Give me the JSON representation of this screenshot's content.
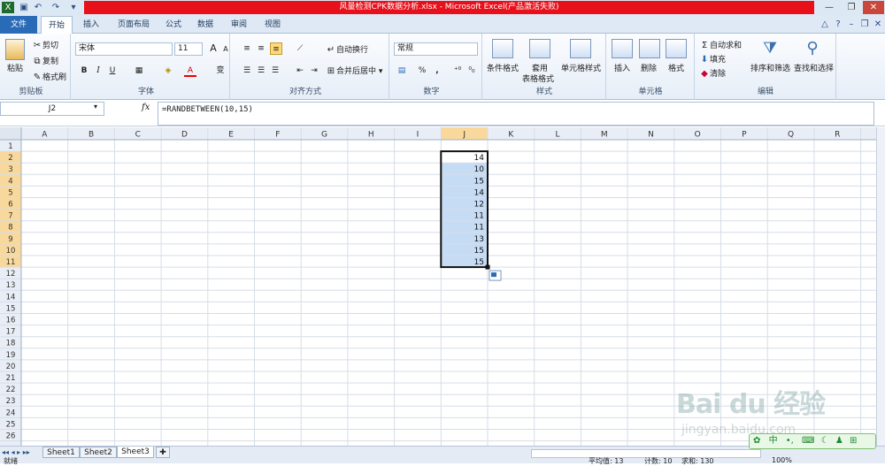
{
  "window": {
    "title": "风量检测CPK数据分析.xlsx  -  Microsoft Excel(产品激活失败)"
  },
  "ribbon_tabs": [
    "文件",
    "开始",
    "插入",
    "页面布局",
    "公式",
    "数据",
    "审阅",
    "视图"
  ],
  "clipboard": {
    "paste": "粘贴",
    "cut": "剪切",
    "copy": "复制",
    "format_painter": "格式刷",
    "group": "剪贴板"
  },
  "font": {
    "name": "宋体",
    "size": "11",
    "group": "字体",
    "bold": "B",
    "italic": "I",
    "underline": "U",
    "increase": "A",
    "decrease": "A",
    "font_color": "A",
    "wen": "变"
  },
  "align": {
    "wrap": "自动换行",
    "merge": "合并后居中",
    "group": "对齐方式"
  },
  "number": {
    "format": "常规",
    "percent": "%",
    "comma": ",",
    "group": "数字"
  },
  "styles": {
    "cond": "条件格式",
    "table1": "套用",
    "table2": "表格格式",
    "cell_style": "单元格样式",
    "group": "样式"
  },
  "cells": {
    "insert": "插入",
    "delete": "删除",
    "format": "格式",
    "group": "单元格"
  },
  "editing": {
    "autosum": "自动求和",
    "fill": "填充",
    "clear": "清除",
    "sort": "排序和筛选",
    "find": "查找和选择",
    "group": "编辑",
    "sigma": "Σ"
  },
  "formula_bar": {
    "name_box": "J2",
    "fx": "fx",
    "formula": "=RANDBETWEEN(10,15)"
  },
  "columns": [
    "A",
    "B",
    "C",
    "D",
    "E",
    "F",
    "G",
    "H",
    "I",
    "J",
    "K",
    "L",
    "M",
    "N",
    "O",
    "P",
    "Q",
    "R"
  ],
  "rows": [
    "1",
    "2",
    "3",
    "4",
    "5",
    "6",
    "7",
    "8",
    "9",
    "10",
    "11",
    "12",
    "13",
    "14",
    "15",
    "16",
    "17",
    "18",
    "19",
    "20",
    "21",
    "22",
    "23",
    "24",
    "25",
    "26"
  ],
  "j_values": [
    "14",
    "10",
    "15",
    "14",
    "12",
    "11",
    "11",
    "13",
    "15",
    "15"
  ],
  "sheets": [
    "Sheet1",
    "Sheet2",
    "Sheet3"
  ],
  "status": {
    "ready": "就绪",
    "average": "平均值: 13",
    "count": "计数: 10",
    "sum": "求和: 130",
    "zoom": "100%"
  },
  "watermark": {
    "text": "Bai du 经验",
    "url": "jingyan.baidu.com"
  },
  "ime": {
    "lang": "中",
    "dot": "•,"
  },
  "colors": {
    "selection": "#c6dcf5",
    "active_header": "#f9d99b",
    "title_red": "#e8101a",
    "file_tab": "#2a6bb8"
  }
}
